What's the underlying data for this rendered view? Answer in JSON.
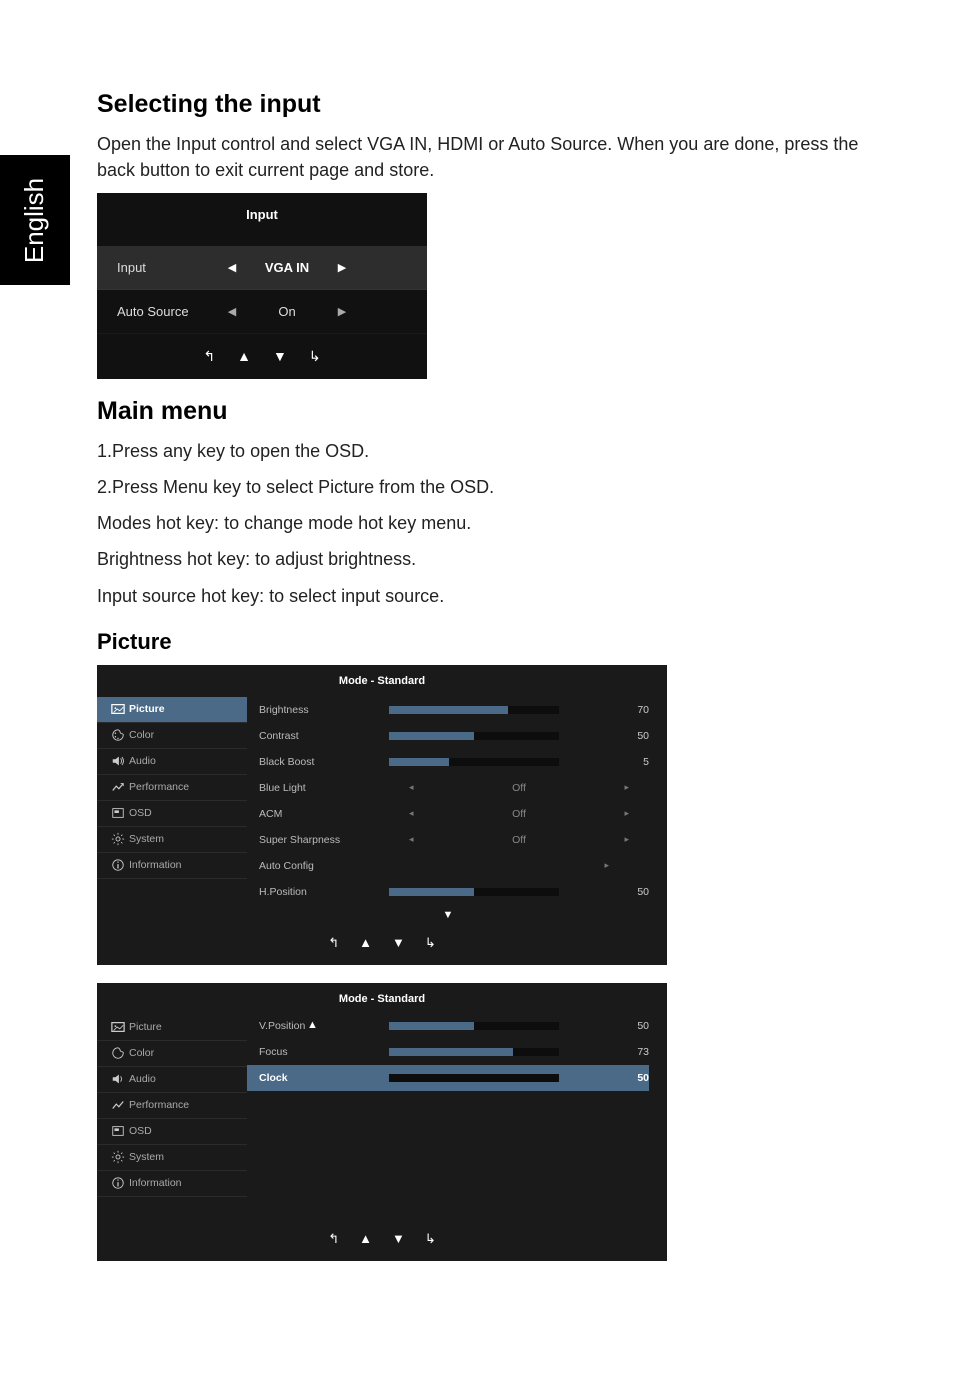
{
  "language_tab": "English",
  "sections": {
    "input_heading": "Selecting the input",
    "input_body": "Open the Input control and select VGA IN, HDMI or Auto Source. When you are done, press the back button to exit current page and store.",
    "main_menu_heading": "Main menu",
    "main_menu_lines": {
      "l1": "1.Press any key to open the OSD.",
      "l2": "2.Press Menu key to select Picture from the OSD.",
      "l3": "Modes hot key: to change mode hot key menu.",
      "l4": "Brightness hot key: to adjust brightness.",
      "l5": "Input source hot key: to select  input source."
    },
    "picture_heading": "Picture"
  },
  "input_panel": {
    "title": "Input",
    "rows": {
      "input": {
        "label": "Input",
        "value": "VGA IN"
      },
      "auto_source": {
        "label": "Auto Source",
        "value": "On"
      }
    }
  },
  "osd_side_items": {
    "picture": "Picture",
    "color": "Color",
    "audio": "Audio",
    "performance": "Performance",
    "osd": "OSD",
    "system": "System",
    "information": "Information"
  },
  "osd_panel1": {
    "mode_title": "Mode - Standard",
    "rows": {
      "brightness": {
        "label": "Brightness",
        "value": 70,
        "fill": 70
      },
      "contrast": {
        "label": "Contrast",
        "value": 50,
        "fill": 50
      },
      "black_boost": {
        "label": "Black Boost",
        "value": 5,
        "fill": 35
      },
      "blue_light": {
        "label": "Blue Light",
        "option": "Off"
      },
      "acm": {
        "label": "ACM",
        "option": "Off"
      },
      "super_sharpness": {
        "label": "Super Sharpness",
        "option": "Off"
      },
      "auto_config": {
        "label": "Auto Config"
      },
      "h_position": {
        "label": "H.Position",
        "value": 50,
        "fill": 50
      }
    }
  },
  "osd_panel2": {
    "mode_title": "Mode - Standard",
    "rows": {
      "v_position": {
        "label": "V.Position",
        "value": 50,
        "fill": 50
      },
      "focus": {
        "label": "Focus",
        "value": 73,
        "fill": 73
      },
      "clock": {
        "label": "Clock",
        "value": 50,
        "fill": 50
      }
    }
  },
  "arrows": {
    "left": "‹",
    "right": "›",
    "up": "▲",
    "down": "▼",
    "tri_left": "◀",
    "tri_right": "▶",
    "small_left": "◂",
    "small_right": "▸"
  }
}
